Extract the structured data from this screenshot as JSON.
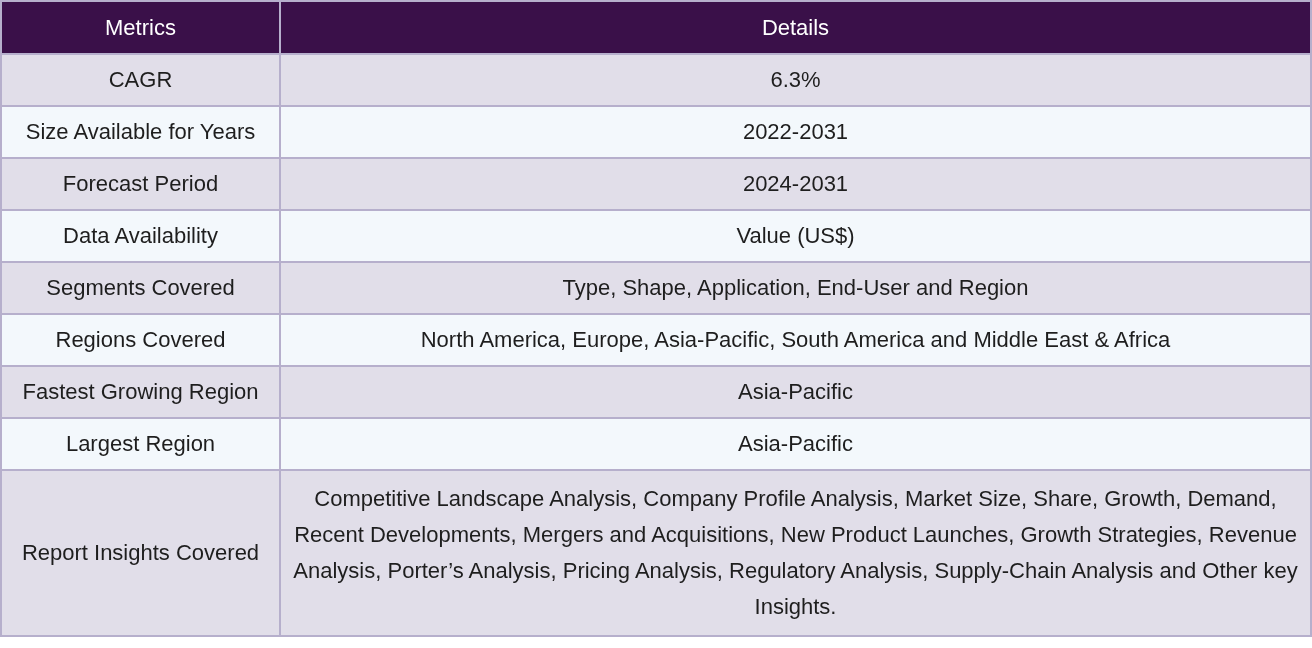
{
  "table": {
    "columns": [
      "Metrics",
      "Details"
    ],
    "rows": [
      {
        "metric": "CAGR",
        "detail": "6.3%"
      },
      {
        "metric": "Size Available for Years",
        "detail": "2022-2031"
      },
      {
        "metric": "Forecast Period",
        "detail": "2024-2031"
      },
      {
        "metric": "Data Availability",
        "detail": "Value (US$)"
      },
      {
        "metric": "Segments Covered",
        "detail": "Type, Shape, Application, End-User and Region"
      },
      {
        "metric": "Regions Covered",
        "detail": "North America, Europe, Asia-Pacific, South America and Middle East & Africa"
      },
      {
        "metric": "Fastest Growing Region",
        "detail": "Asia-Pacific"
      },
      {
        "metric": "Largest Region",
        "detail": "Asia-Pacific"
      },
      {
        "metric": "Report Insights Covered",
        "detail": "Competitive Landscape Analysis, Company Profile Analysis, Market Size, Share, Growth, Demand, Recent Developments, Mergers and Acquisitions, New Product Launches, Growth Strategies, Revenue Analysis, Porter’s Analysis, Pricing Analysis, Regulatory Analysis, Supply-Chain Analysis and Other key Insights."
      }
    ]
  }
}
